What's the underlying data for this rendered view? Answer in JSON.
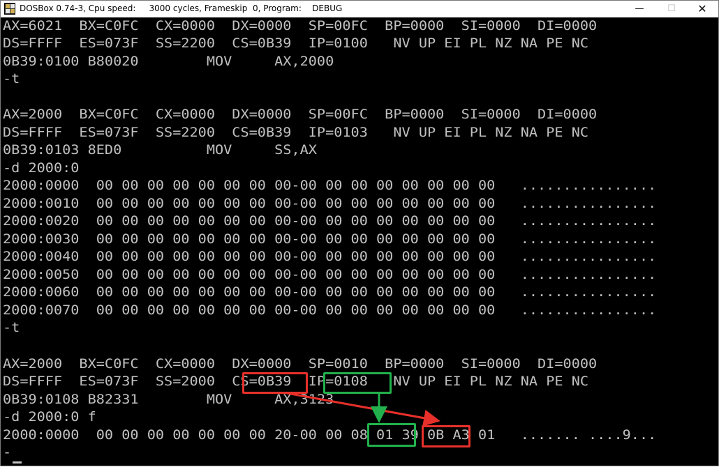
{
  "window": {
    "title": "DOSBox 0.74-3, Cpu speed:     3000 cycles, Frameskip  0, Program:    DEBUG",
    "icon": "dosbox-app-icon",
    "minimize_glyph": "—",
    "maximize_glyph": "☐",
    "close_glyph": "✕"
  },
  "terminal": {
    "lines": [
      "AX=6021  BX=C0FC  CX=0000  DX=0000  SP=00FC  BP=0000  SI=0000  DI=0000",
      "DS=FFFF  ES=073F  SS=2200  CS=0B39  IP=0100   NV UP EI PL NZ NA PE NC",
      "0B39:0100 B80020        MOV     AX,2000",
      "-t",
      "",
      "AX=2000  BX=C0FC  CX=0000  DX=0000  SP=00FC  BP=0000  SI=0000  DI=0000",
      "DS=FFFF  ES=073F  SS=2200  CS=0B39  IP=0103   NV UP EI PL NZ NA PE NC",
      "0B39:0103 8ED0          MOV     SS,AX",
      "-d 2000:0",
      "2000:0000  00 00 00 00 00 00 00 00-00 00 00 00 00 00 00 00   ................",
      "2000:0010  00 00 00 00 00 00 00 00-00 00 00 00 00 00 00 00   ................",
      "2000:0020  00 00 00 00 00 00 00 00-00 00 00 00 00 00 00 00   ................",
      "2000:0030  00 00 00 00 00 00 00 00-00 00 00 00 00 00 00 00   ................",
      "2000:0040  00 00 00 00 00 00 00 00-00 00 00 00 00 00 00 00   ................",
      "2000:0050  00 00 00 00 00 00 00 00-00 00 00 00 00 00 00 00   ................",
      "2000:0060  00 00 00 00 00 00 00 00-00 00 00 00 00 00 00 00   ................",
      "2000:0070  00 00 00 00 00 00 00 00-00 00 00 00 00 00 00 00   ................",
      "-t",
      "",
      "AX=2000  BX=C0FC  CX=0000  DX=0000  SP=0010  BP=0000  SI=0000  DI=0000",
      "DS=FFFF  ES=073F  SS=2000  CS=0B39  IP=0108   NV UP EI PL NZ NA PE NC",
      "0B39:0108 B82331        MOV     AX,3123",
      "-d 2000:0 f",
      "2000:0000  00 00 00 00 00 00 00 20-00 00 08 01 39 0B A3 01   ....... ....9...",
      "-"
    ]
  },
  "annotations": {
    "red_color": "#e8302a",
    "green_color": "#22b14c"
  }
}
